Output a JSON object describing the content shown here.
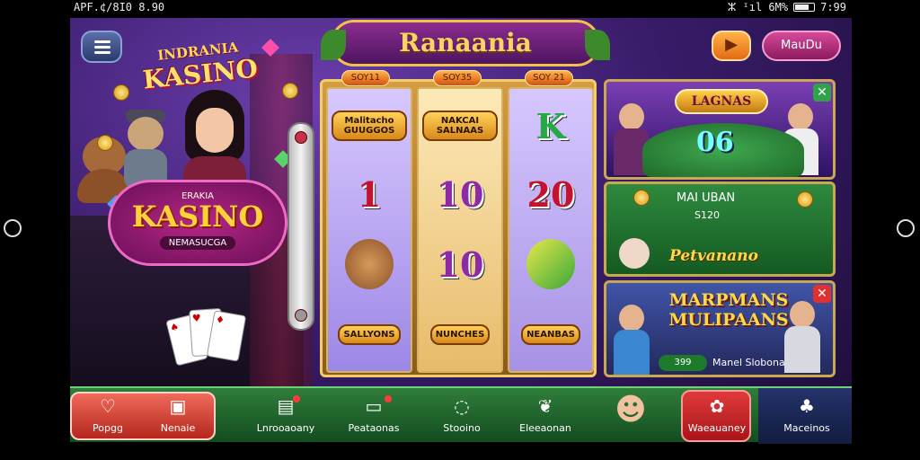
{
  "status_bar": {
    "left_text": "APF.¢/8I0 8.90",
    "right_text": "ⵣ ᴵ᠎ıl 6M%",
    "time": "7:99"
  },
  "header": {
    "title": "Ranaania",
    "right_button": "MauDu"
  },
  "logo": {
    "small_line1": "INDRANIA",
    "small_line2": "KASINO",
    "badge_top": "ERAKIA",
    "badge_main": "KASINO",
    "badge_sub": "NEMASUCGA"
  },
  "reels": {
    "tags": [
      "SOY11",
      "SOY35",
      "SOY 21"
    ],
    "reel1": [
      {
        "type": "pill",
        "text": "Malitacho GUUGGOS"
      },
      {
        "type": "big",
        "text": "1",
        "color": "#c4132e"
      },
      {
        "type": "cartoon",
        "name": "bear"
      },
      {
        "type": "pill",
        "text": "SALLYONS"
      }
    ],
    "reel2": [
      {
        "type": "pill",
        "text": "NAKCAI SALNAAS"
      },
      {
        "type": "big",
        "text": "10",
        "color": "#8e2aa8"
      },
      {
        "type": "big",
        "text": "10",
        "color": "#8e2aa8"
      },
      {
        "type": "pill",
        "text": "NUNCHES"
      }
    ],
    "reel3": [
      {
        "type": "big",
        "text": "K",
        "color": "#26a845"
      },
      {
        "type": "big",
        "text": "20",
        "color": "#c4132e"
      },
      {
        "type": "cartoon",
        "name": "banana"
      },
      {
        "type": "pill",
        "text": "NEANBAS"
      }
    ]
  },
  "panels": {
    "p1": {
      "title": "LAGNAS",
      "value": "06"
    },
    "p2": {
      "line1": "MAI UBAN",
      "line2": "S120",
      "line3": "Petvanano"
    },
    "p3": {
      "line1": "MARPMANS MULIPAANS",
      "badge": "399",
      "line2": "Manel Slobona"
    }
  },
  "bottom_nav": [
    {
      "label": "Popgg",
      "icon": "♡"
    },
    {
      "label": "Nenaie",
      "icon": "▣"
    },
    {
      "label": "Lnrooaoany",
      "icon": "▤"
    },
    {
      "label": "Peataonas",
      "icon": "▭"
    },
    {
      "label": "Stooino",
      "icon": "◌"
    },
    {
      "label": "Eleeaonan",
      "icon": "❦"
    },
    {
      "label": "",
      "icon": "☻"
    },
    {
      "label": "Waeauaney",
      "icon": "✿"
    },
    {
      "label": "Maceinos",
      "icon": "♣"
    }
  ],
  "colors": {
    "accent": "#f1c14a",
    "panel_green": "#2e8a3e",
    "panel_purple": "#7b3fb4",
    "bar_green": "#2f7d3a",
    "red": "#e03a3a"
  }
}
